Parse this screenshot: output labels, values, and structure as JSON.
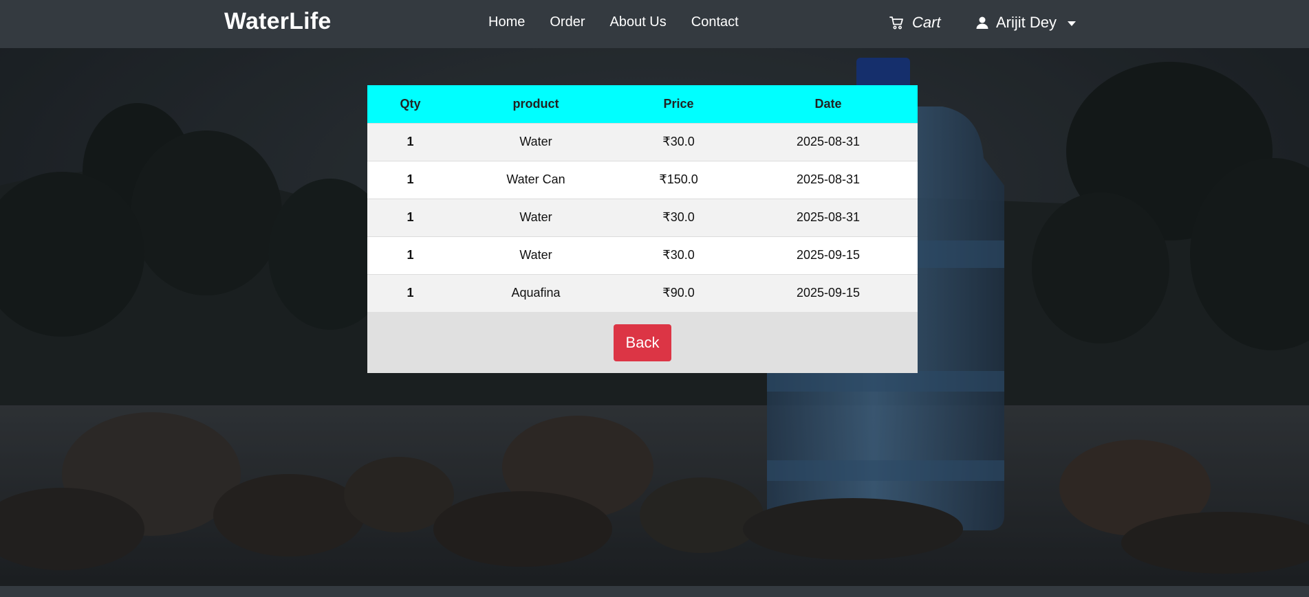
{
  "navbar": {
    "brand": "WaterLife",
    "links": [
      "Home",
      "Order",
      "About Us",
      "Contact"
    ],
    "cart_label": "Cart",
    "user_name": "Arijit Dey"
  },
  "orders_table": {
    "headers": [
      "Qty",
      "product",
      "Price",
      "Date"
    ],
    "rows": [
      {
        "qty": "1",
        "product": "Water",
        "price": "₹30.0",
        "date": "2025-08-31"
      },
      {
        "qty": "1",
        "product": "Water Can",
        "price": "₹150.0",
        "date": "2025-08-31"
      },
      {
        "qty": "1",
        "product": "Water",
        "price": "₹30.0",
        "date": "2025-08-31"
      },
      {
        "qty": "1",
        "product": "Water",
        "price": "₹30.0",
        "date": "2025-09-15"
      },
      {
        "qty": "1",
        "product": "Aquafina",
        "price": "₹90.0",
        "date": "2025-09-15"
      }
    ],
    "back_label": "Back"
  },
  "colors": {
    "navbar_bg": "#343a40",
    "table_header_bg": "#00ffff",
    "back_button_bg": "#dc3545"
  }
}
